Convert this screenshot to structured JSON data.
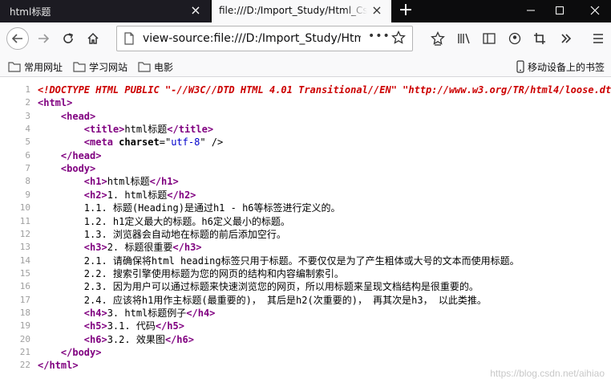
{
  "tabs": [
    {
      "title": "html标题",
      "active": false
    },
    {
      "title": "file:///D:/Import_Study/Html_Css",
      "active": true
    }
  ],
  "icons": {
    "new_tab": "plus-icon",
    "back": "back-arrow-icon",
    "forward": "forward-arrow-icon",
    "reload": "reload-icon",
    "home": "home-icon",
    "page": "page-icon",
    "more": "ellipsis-icon",
    "bookmark_star": "star-icon",
    "library": "library-icon",
    "sidebar": "sidebar-icon",
    "account": "account-icon",
    "screenshot": "crop-icon",
    "overflow": "double-chevron-icon",
    "menu": "hamburger-icon",
    "folder": "folder-icon",
    "mobile": "mobile-icon"
  },
  "url": "view-source:file:///D:/Import_Study/Html_Css",
  "bookmarks": [
    {
      "label": "常用网址"
    },
    {
      "label": "学习网站"
    },
    {
      "label": "电影"
    }
  ],
  "mobile_bookmarks": "移动设备上的书签",
  "source_lines": [
    {
      "n": "1",
      "indent": "",
      "parts": [
        {
          "t": "<!DOCTYPE HTML PUBLIC \"-//W3C//DTD HTML 4.01 Transitional//EN\" \"http://www.w3.org/TR/html4/loose.dtd\">",
          "k": "doctype"
        }
      ]
    },
    {
      "n": "2",
      "indent": "",
      "parts": [
        {
          "t": "<html>",
          "k": "tag"
        }
      ]
    },
    {
      "n": "3",
      "indent": "    ",
      "parts": [
        {
          "t": "<head>",
          "k": "tag"
        }
      ]
    },
    {
      "n": "4",
      "indent": "        ",
      "parts": [
        {
          "t": "<title>",
          "k": "tag"
        },
        {
          "t": "html标题",
          "k": "text"
        },
        {
          "t": "</title>",
          "k": "tag"
        }
      ]
    },
    {
      "n": "5",
      "indent": "        ",
      "parts": [
        {
          "t": "<meta ",
          "k": "tag"
        },
        {
          "t": "charset",
          "k": "attr"
        },
        {
          "t": "=\"",
          "k": "text"
        },
        {
          "t": "utf-8",
          "k": "val"
        },
        {
          "t": "\" />",
          "k": "text"
        }
      ]
    },
    {
      "n": "6",
      "indent": "    ",
      "parts": [
        {
          "t": "</head>",
          "k": "tag"
        }
      ]
    },
    {
      "n": "7",
      "indent": "    ",
      "parts": [
        {
          "t": "<body>",
          "k": "tag"
        }
      ]
    },
    {
      "n": "8",
      "indent": "        ",
      "parts": [
        {
          "t": "<h1>",
          "k": "tag"
        },
        {
          "t": "html标题",
          "k": "text"
        },
        {
          "t": "</h1>",
          "k": "tag"
        }
      ]
    },
    {
      "n": "9",
      "indent": "        ",
      "parts": [
        {
          "t": "<h2>",
          "k": "tag"
        },
        {
          "t": "1. html标题",
          "k": "text"
        },
        {
          "t": "</h2>",
          "k": "tag"
        }
      ]
    },
    {
      "n": "10",
      "indent": "        ",
      "parts": [
        {
          "t": "1.1. 标题(Heading)是通过h1 - h6等标签进行定义的。",
          "k": "text"
        }
      ]
    },
    {
      "n": "11",
      "indent": "        ",
      "parts": [
        {
          "t": "1.2. h1定义最大的标题。h6定义最小的标题。",
          "k": "text"
        }
      ]
    },
    {
      "n": "12",
      "indent": "        ",
      "parts": [
        {
          "t": "1.3. 浏览器会自动地在标题的前后添加空行。",
          "k": "text"
        }
      ]
    },
    {
      "n": "13",
      "indent": "        ",
      "parts": [
        {
          "t": "<h3>",
          "k": "tag"
        },
        {
          "t": "2. 标题很重要",
          "k": "text"
        },
        {
          "t": "</h3>",
          "k": "tag"
        }
      ]
    },
    {
      "n": "14",
      "indent": "        ",
      "parts": [
        {
          "t": "2.1. 请确保将html heading标签只用于标题。不要仅仅是为了产生粗体或大号的文本而使用标题。",
          "k": "text"
        }
      ]
    },
    {
      "n": "15",
      "indent": "        ",
      "parts": [
        {
          "t": "2.2. 搜索引擎使用标题为您的网页的结构和内容编制索引。",
          "k": "text"
        }
      ]
    },
    {
      "n": "16",
      "indent": "        ",
      "parts": [
        {
          "t": "2.3. 因为用户可以通过标题来快速浏览您的网页，所以用标题来呈现文档结构是很重要的。",
          "k": "text"
        }
      ]
    },
    {
      "n": "17",
      "indent": "        ",
      "parts": [
        {
          "t": "2.4. 应该将h1用作主标题(最重要的)， 其后是h2(次重要的)， 再其次是h3， 以此类推。",
          "k": "text"
        }
      ]
    },
    {
      "n": "18",
      "indent": "        ",
      "parts": [
        {
          "t": "<h4>",
          "k": "tag"
        },
        {
          "t": "3. html标题例子",
          "k": "text"
        },
        {
          "t": "</h4>",
          "k": "tag"
        }
      ]
    },
    {
      "n": "19",
      "indent": "        ",
      "parts": [
        {
          "t": "<h5>",
          "k": "tag"
        },
        {
          "t": "3.1. 代码",
          "k": "text"
        },
        {
          "t": "</h5>",
          "k": "tag"
        }
      ]
    },
    {
      "n": "20",
      "indent": "        ",
      "parts": [
        {
          "t": "<h6>",
          "k": "tag"
        },
        {
          "t": "3.2. 效果图",
          "k": "text"
        },
        {
          "t": "</h6>",
          "k": "tag"
        }
      ]
    },
    {
      "n": "21",
      "indent": "    ",
      "parts": [
        {
          "t": "</body>",
          "k": "tag"
        }
      ]
    },
    {
      "n": "22",
      "indent": "",
      "parts": [
        {
          "t": "</html>",
          "k": "tag"
        }
      ]
    }
  ],
  "watermark": "https://blog.csdn.net/aihiao"
}
